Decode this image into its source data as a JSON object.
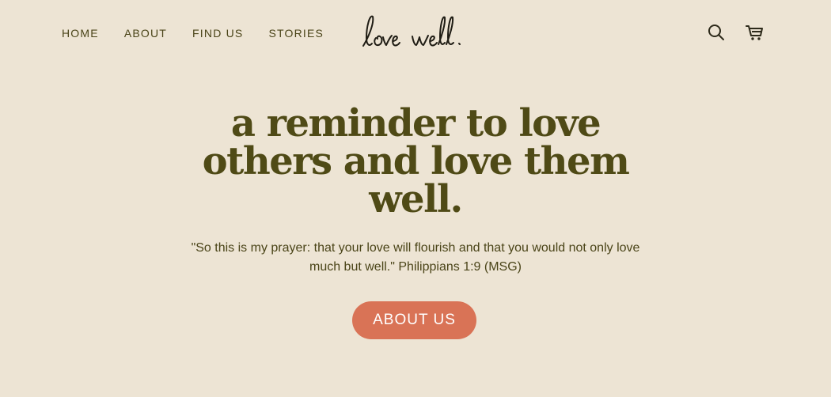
{
  "header": {
    "nav": [
      {
        "label": "HOME"
      },
      {
        "label": "ABOUT"
      },
      {
        "label": "FIND US"
      },
      {
        "label": "STORIES"
      }
    ],
    "logo_text": "love well."
  },
  "hero": {
    "title": "a reminder to love others and love them well.",
    "quote": "\"So this is my prayer: that your love will flourish and that you would not only love much but well.\" Philippians 1:9 (MSG)",
    "cta_label": "ABOUT US"
  },
  "icons": {
    "search": "search-icon",
    "cart": "cart-icon"
  },
  "colors": {
    "background": "#ede4d4",
    "text": "#4a4418",
    "title": "#4f4a16",
    "accent": "#d97356"
  }
}
